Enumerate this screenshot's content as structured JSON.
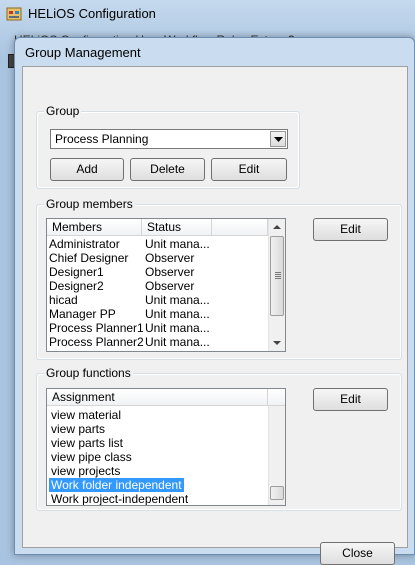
{
  "parent_window": {
    "title": "HELiOS Configuration",
    "menubar_text": "HELiOS Configuration   User   Workflow   Rules   Extras   ?"
  },
  "dialog": {
    "title": "Group Management",
    "group": {
      "legend": "Group",
      "selected": "Process Planning",
      "add_label": "Add",
      "delete_label": "Delete",
      "edit_label": "Edit"
    },
    "members": {
      "legend": "Group members",
      "columns": [
        "Members",
        "Status"
      ],
      "rows": [
        {
          "member": "Administrator",
          "status": "Unit mana..."
        },
        {
          "member": "Chief Designer",
          "status": "Observer"
        },
        {
          "member": "Designer1",
          "status": "Observer"
        },
        {
          "member": "Designer2",
          "status": "Observer"
        },
        {
          "member": "hicad",
          "status": "Unit mana..."
        },
        {
          "member": "Manager PP",
          "status": "Unit mana..."
        },
        {
          "member": "Process Planner1",
          "status": "Unit mana..."
        },
        {
          "member": "Process Planner2",
          "status": "Unit mana..."
        }
      ],
      "edit_label": "Edit"
    },
    "functions": {
      "legend": "Group functions",
      "columns": [
        "Assignment"
      ],
      "rows": [
        {
          "assignment": "view material",
          "selected": false
        },
        {
          "assignment": "view parts",
          "selected": false
        },
        {
          "assignment": "view parts list",
          "selected": false
        },
        {
          "assignment": "view pipe class",
          "selected": false
        },
        {
          "assignment": "view projects",
          "selected": false
        },
        {
          "assignment": "Work folder independent",
          "selected": true
        },
        {
          "assignment": "Work project-independent",
          "selected": false
        }
      ],
      "edit_label": "Edit"
    },
    "close_label": "Close"
  }
}
